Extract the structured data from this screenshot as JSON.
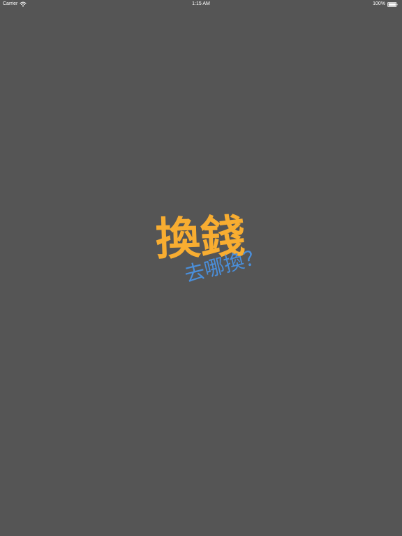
{
  "status_bar": {
    "carrier": "Carrier",
    "time": "1:15 AM",
    "battery": "100%",
    "wifi_icon": "wifi-icon",
    "battery_icon": "battery-icon"
  },
  "splash": {
    "title": "換錢",
    "subtitle": "去哪換？"
  },
  "colors": {
    "background": "#555555",
    "title": "#f8ad31",
    "subtitle": "#4a8fdb",
    "status_text": "#ffffff"
  }
}
